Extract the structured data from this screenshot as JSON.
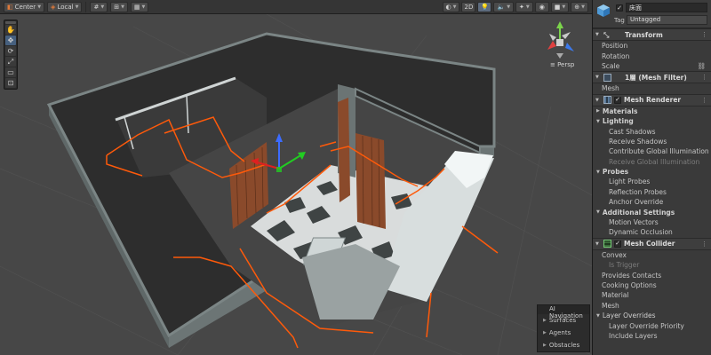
{
  "toolbar": {
    "pivot_mode": "Center",
    "pivot_rotation": "Local",
    "view_2d": "2D"
  },
  "tools": [
    "hand-tool",
    "move-tool",
    "rotate-tool",
    "scale-tool",
    "rect-tool",
    "transform-tool"
  ],
  "gizmo": {
    "projection": "≡ Persp"
  },
  "ai_navigation": {
    "title": "AI Navigation",
    "items": [
      "Surfaces",
      "Agents",
      "Obstacles"
    ]
  },
  "inspector": {
    "object_name": "床面",
    "tag_label": "Tag",
    "tag_value": "Untagged",
    "transform": {
      "title": "Transform",
      "props": [
        "Position",
        "Rotation",
        "Scale"
      ]
    },
    "mesh_filter": {
      "title": "1層 (Mesh Filter)",
      "props": [
        "Mesh"
      ]
    },
    "mesh_renderer": {
      "title": "Mesh Renderer",
      "materials": "Materials",
      "lighting": "Lighting",
      "lighting_props": [
        "Cast Shadows",
        "Receive Shadows",
        "Contribute Global Illumination"
      ],
      "lighting_disabled": "Receive Global Illumination",
      "probes": "Probes",
      "probes_props": [
        "Light Probes",
        "Reflection Probes",
        "Anchor Override"
      ],
      "additional": "Additional Settings",
      "additional_props": [
        "Motion Vectors",
        "Dynamic Occlusion"
      ]
    },
    "mesh_collider": {
      "title": "Mesh Collider",
      "convex": "Convex",
      "is_trigger": "Is Trigger",
      "props": [
        "Provides Contacts",
        "Cooking Options",
        "Material",
        "Mesh"
      ],
      "layer_overrides": "Layer Overrides",
      "layer_props": [
        "Layer Override Priority",
        "Include Layers"
      ]
    }
  },
  "colors": {
    "scene_bg": "#474747",
    "wall_top": "#2a2a2a",
    "wall_side": "#6b7474",
    "selection_outline": "#ff5a0a",
    "door_wood": "#8a4a2b"
  }
}
